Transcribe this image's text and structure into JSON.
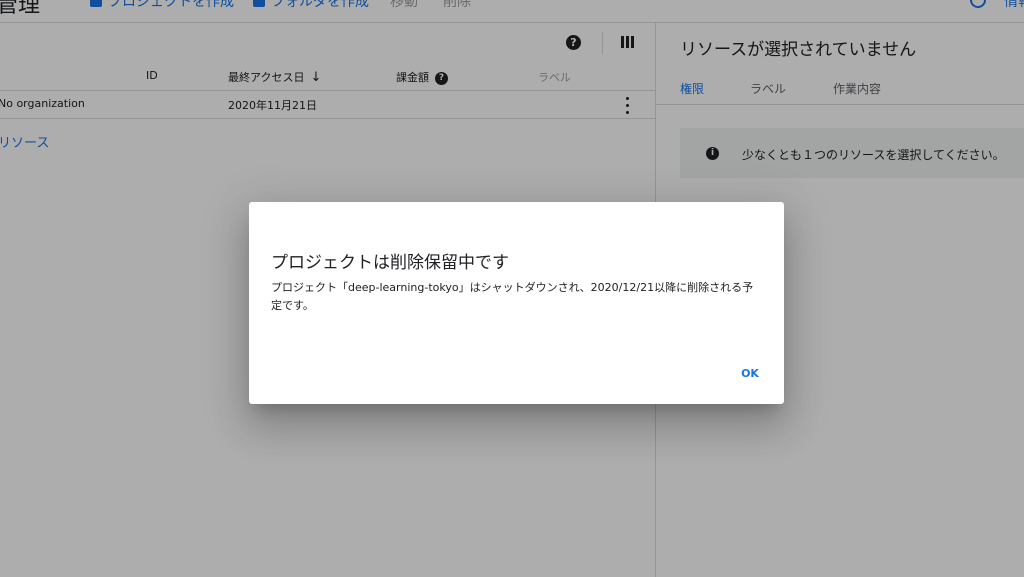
{
  "header": {
    "title": "管理",
    "create_project": "プロジェクトを作成",
    "create_folder": "フォルダを作成",
    "move": "移動",
    "delete": "削除",
    "info_link": "情報"
  },
  "table": {
    "columns": {
      "name": "",
      "id": "ID",
      "last_access": "最終アクセス日",
      "billing": "課金額",
      "labels": "ラベル"
    },
    "rows": [
      {
        "name": "No organization",
        "id": "",
        "last_access": "2020年11月21日",
        "billing": "",
        "labels": ""
      }
    ],
    "resources_link": "リソース"
  },
  "side_panel": {
    "title": "リソースが選択されていません",
    "tabs": [
      "権限",
      "ラベル",
      "作業内容"
    ],
    "active_tab": 0,
    "info_message": "少なくとも１つのリソースを選択してください。"
  },
  "dialog": {
    "title": "プロジェクトは削除保留中です",
    "body": "プロジェクト「deep-learning-tokyo」はシャットダウンされ、2020/12/21以降に削除される予定です。",
    "ok_label": "OK"
  },
  "colors": {
    "accent": "#1a73e8",
    "scrim": "rgba(0,0,0,0.32)",
    "panel_bg": "#f1f3f4"
  },
  "icons": {
    "help": "?",
    "info": "i",
    "sort": "↓"
  }
}
